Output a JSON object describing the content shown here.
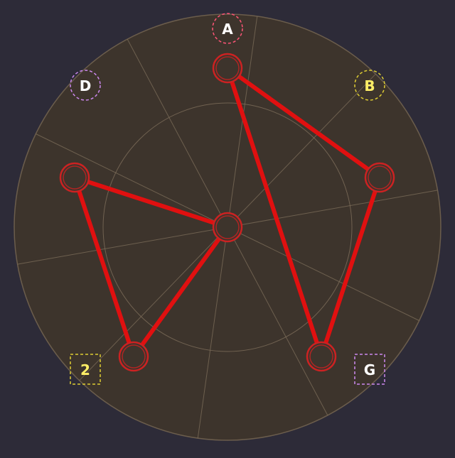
{
  "board": {
    "background_color": "#2d2b38",
    "disc_color": "#3d342c",
    "disc_stroke": "#6b5d4c",
    "spoke_color": "#7a6b58",
    "inner_ring_color": "#7a6b58",
    "spoke_count": 10,
    "line_color": "#e01010",
    "node_color": "#cc2222"
  },
  "nodes": [
    {
      "id": "top"
    },
    {
      "id": "right-upper"
    },
    {
      "id": "right-lower"
    },
    {
      "id": "left-lower"
    },
    {
      "id": "left-upper"
    },
    {
      "id": "center"
    }
  ],
  "path": [
    "right-upper",
    "top",
    "right-lower",
    "right-upper"
  ],
  "path_segments": [
    [
      "top",
      "right-upper"
    ],
    [
      "top",
      "right-lower"
    ],
    [
      "right-upper",
      "right-lower"
    ],
    [
      "left-upper",
      "center"
    ],
    [
      "left-upper",
      "left-lower"
    ],
    [
      "left-lower",
      "center"
    ]
  ],
  "markers": [
    {
      "id": "marker-a",
      "glyph": "A",
      "shape": "circle",
      "color": "#ff5577",
      "text_color": "#ffffff"
    },
    {
      "id": "marker-d",
      "glyph": "D",
      "shape": "circle",
      "color": "#cc88ee",
      "text_color": "#ffffff"
    },
    {
      "id": "marker-b",
      "glyph": "B",
      "shape": "circle",
      "color": "#ddcc33",
      "text_color": "#ffee66"
    },
    {
      "id": "marker-2",
      "glyph": "2",
      "shape": "square",
      "color": "#ddcc33",
      "text_color": "#ffee66"
    },
    {
      "id": "marker-g",
      "glyph": "G",
      "shape": "square",
      "color": "#cc88ee",
      "text_color": "#ffffff"
    }
  ]
}
